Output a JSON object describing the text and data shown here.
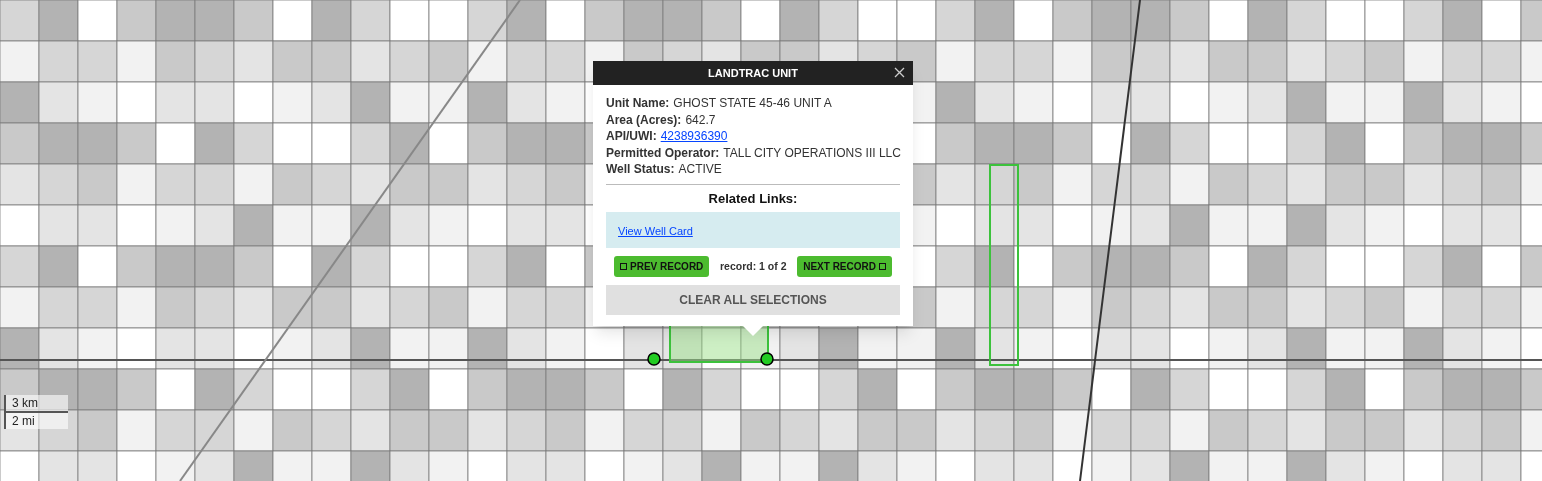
{
  "popup": {
    "title": "LANDTRAC UNIT",
    "fields": [
      {
        "label": "Unit Name:",
        "value": "GHOST STATE 45-46 UNIT A",
        "kind": "text"
      },
      {
        "label": "Area (Acres):",
        "value": "642.7",
        "kind": "text"
      },
      {
        "label": "API/UWI:",
        "value": "4238936390",
        "kind": "link"
      },
      {
        "label": "Permitted Operator:",
        "value": "TALL CITY OPERATIONS III LLC",
        "kind": "text"
      },
      {
        "label": "Well Status:",
        "value": "ACTIVE",
        "kind": "text"
      }
    ],
    "related_links_heading": "Related Links:",
    "related_links": [
      "View Well Card"
    ],
    "prev_button": "PREV RECORD",
    "record_counter": "record: 1 of 2",
    "next_button": "NEXT RECORD",
    "clear_button": "CLEAR ALL SELECTIONS"
  },
  "scale_bar": {
    "metric": "3 km",
    "imperial": "2 mi"
  }
}
